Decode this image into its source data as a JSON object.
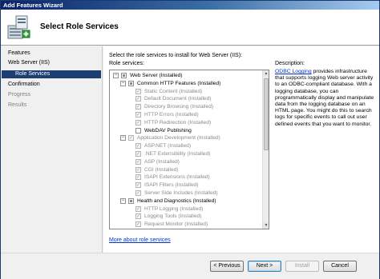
{
  "window": {
    "title": "Add Features Wizard"
  },
  "header": {
    "title": "Select Role Services"
  },
  "nav": {
    "items": [
      {
        "label": "Features",
        "state": "normal"
      },
      {
        "label": "Web Server (IIS)",
        "state": "normal"
      },
      {
        "label": "Role Services",
        "state": "active"
      },
      {
        "label": "Confirmation",
        "state": "normal"
      },
      {
        "label": "Progress",
        "state": "muted"
      },
      {
        "label": "Results",
        "state": "muted"
      }
    ]
  },
  "main": {
    "instruction": "Select the role services to install for Web Server (IIS):",
    "role_services_label": "Role services:",
    "description_label": "Description:",
    "more_link": "More about role services",
    "tree": [
      {
        "level": 0,
        "expander": "−",
        "check": "partial",
        "disabled": false,
        "label": "Web Server  (Installed)"
      },
      {
        "level": 1,
        "expander": "−",
        "check": "partial",
        "disabled": false,
        "label": "Common HTTP Features  (Installed)"
      },
      {
        "level": 2,
        "expander": "",
        "check": "checked",
        "disabled": true,
        "label": "Static Content  (Installed)"
      },
      {
        "level": 2,
        "expander": "",
        "check": "checked",
        "disabled": true,
        "label": "Default Document  (Installed)"
      },
      {
        "level": 2,
        "expander": "",
        "check": "checked",
        "disabled": true,
        "label": "Directory Browsing  (Installed)"
      },
      {
        "level": 2,
        "expander": "",
        "check": "checked",
        "disabled": true,
        "label": "HTTP Errors  (Installed)"
      },
      {
        "level": 2,
        "expander": "",
        "check": "checked",
        "disabled": true,
        "label": "HTTP Redirection  (Installed)"
      },
      {
        "level": 2,
        "expander": "",
        "check": "unchecked",
        "disabled": false,
        "label": "WebDAV Publishing"
      },
      {
        "level": 1,
        "expander": "−",
        "check": "checked",
        "disabled": true,
        "label": "Application Development  (Installed)"
      },
      {
        "level": 2,
        "expander": "",
        "check": "checked",
        "disabled": true,
        "label": "ASP.NET  (Installed)"
      },
      {
        "level": 2,
        "expander": "",
        "check": "checked",
        "disabled": true,
        "label": ".NET Extensibility  (Installed)"
      },
      {
        "level": 2,
        "expander": "",
        "check": "checked",
        "disabled": true,
        "label": "ASP  (Installed)"
      },
      {
        "level": 2,
        "expander": "",
        "check": "checked",
        "disabled": true,
        "label": "CGI  (Installed)"
      },
      {
        "level": 2,
        "expander": "",
        "check": "checked",
        "disabled": true,
        "label": "ISAPI Extensions  (Installed)"
      },
      {
        "level": 2,
        "expander": "",
        "check": "checked",
        "disabled": true,
        "label": "ISAPI Filters  (Installed)"
      },
      {
        "level": 2,
        "expander": "",
        "check": "checked",
        "disabled": true,
        "label": "Server Side Includes  (Installed)"
      },
      {
        "level": 1,
        "expander": "−",
        "check": "partial",
        "disabled": false,
        "label": "Health and Diagnostics  (Installed)"
      },
      {
        "level": 2,
        "expander": "",
        "check": "checked",
        "disabled": true,
        "label": "HTTP Logging  (Installed)"
      },
      {
        "level": 2,
        "expander": "",
        "check": "checked",
        "disabled": true,
        "label": "Logging Tools  (Installed)"
      },
      {
        "level": 2,
        "expander": "",
        "check": "checked",
        "disabled": true,
        "label": "Request Monitor  (Installed)"
      }
    ],
    "description": {
      "link": "ODBC Logging",
      "text": " provides infrastructure that supports logging Web server activity to an ODBC-compliant database. With a logging database, you can programmatically display and manipulate data from the logging database on an HTML page. You might do this to search logs for specific events to call out user defined events that you want to monitor."
    }
  },
  "footer": {
    "previous": "< Previous",
    "next": "Next >",
    "install": "Install",
    "cancel": "Cancel"
  },
  "colors": {
    "active_nav_bg": "#1b3f73",
    "link": "#0033cc",
    "titlebar": "#0a246a"
  }
}
